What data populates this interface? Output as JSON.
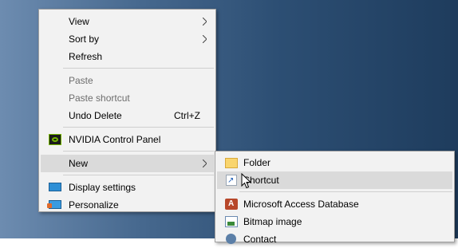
{
  "context_menu": {
    "view": "View",
    "sort_by": "Sort by",
    "refresh": "Refresh",
    "paste": "Paste",
    "paste_shortcut": "Paste shortcut",
    "undo_delete": "Undo Delete",
    "undo_delete_shortcut": "Ctrl+Z",
    "nvidia": "NVIDIA Control Panel",
    "new": "New",
    "display_settings": "Display settings",
    "personalize": "Personalize"
  },
  "new_submenu": {
    "folder": "Folder",
    "shortcut": "Shortcut",
    "access": "Microsoft Access Database",
    "bitmap": "Bitmap image",
    "contact": "Contact"
  },
  "colors": {
    "menu_bg": "#f2f2f2",
    "highlight": "#dadada",
    "disabled_text": "#6d6d6d",
    "desktop_dark": "#1e3c5d",
    "desktop_light": "#6d8cb0"
  }
}
